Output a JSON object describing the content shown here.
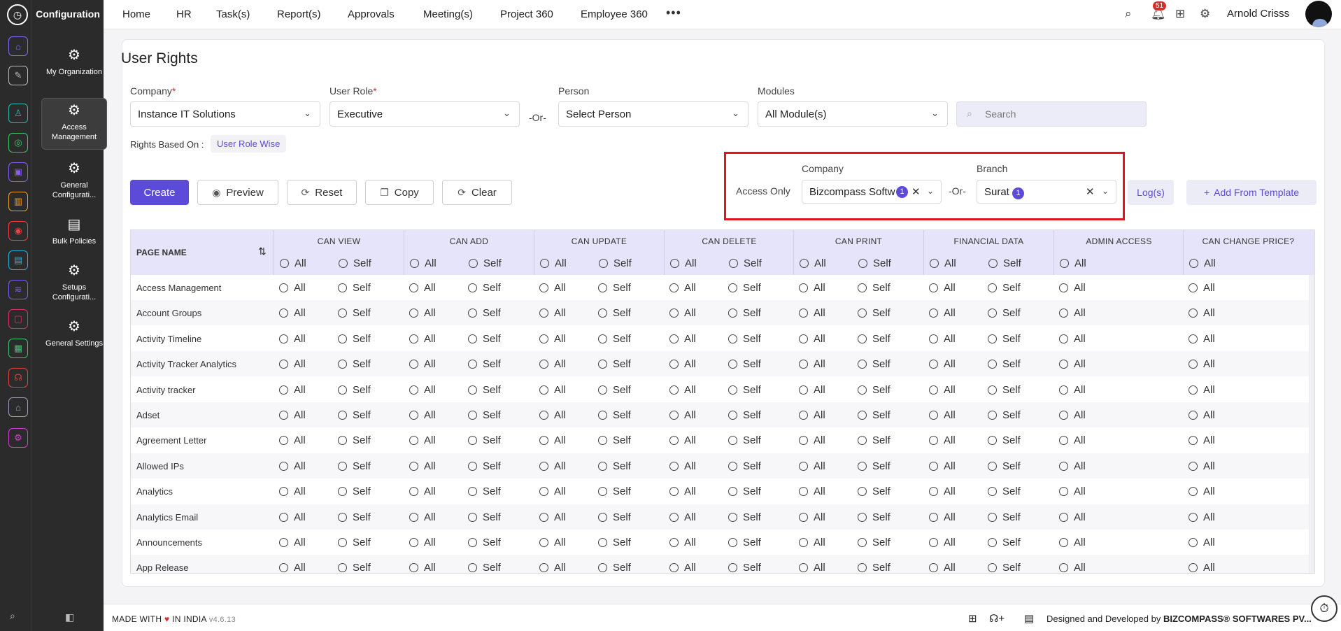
{
  "app": {
    "section_title": "Configuration"
  },
  "rail": {
    "icons": [
      {
        "name": "home-icon",
        "glyph": "⌂",
        "color": "#7a6ff0"
      },
      {
        "name": "pin-icon",
        "glyph": "✎",
        "color": "#bbbbbb"
      },
      {
        "name": "people-icon",
        "glyph": "♙",
        "color": "#2bb8a8"
      },
      {
        "name": "target-icon",
        "glyph": "◎",
        "color": "#3ec46d"
      },
      {
        "name": "briefcase-icon",
        "glyph": "▣",
        "color": "#8a5cf0"
      },
      {
        "name": "chart-icon",
        "glyph": "▥",
        "color": "#f0a020"
      },
      {
        "name": "goal-icon",
        "glyph": "◉",
        "color": "#f04040"
      },
      {
        "name": "document-icon",
        "glyph": "▤",
        "color": "#2ab0e0"
      },
      {
        "name": "layers-icon",
        "glyph": "≋",
        "color": "#7a5cf0"
      },
      {
        "name": "monitor-icon",
        "glyph": "▢",
        "color": "#e0306a"
      },
      {
        "name": "sheet-icon",
        "glyph": "▦",
        "color": "#3ec46d"
      },
      {
        "name": "support-icon",
        "glyph": "☊",
        "color": "#e04040"
      },
      {
        "name": "house-icon",
        "glyph": "⌂",
        "color": "#9aa0b8"
      },
      {
        "name": "settings-app-icon",
        "glyph": "⚙",
        "color": "#d040d0"
      }
    ]
  },
  "sidebar": {
    "items": [
      {
        "label": "My Organization",
        "icon": "org-gear-icon"
      },
      {
        "label": "Access Management",
        "icon": "gear-icon"
      },
      {
        "label": "General Configurati...",
        "icon": "gear-icon"
      },
      {
        "label": "Bulk Policies",
        "icon": "document-icon"
      },
      {
        "label": "Setups Configurati...",
        "icon": "gear-icon"
      },
      {
        "label": "General Settings",
        "icon": "gear-icon"
      }
    ]
  },
  "nav": {
    "items": [
      "Home",
      "HR",
      "Task(s)",
      "Report(s)",
      "Approvals",
      "Meeting(s)",
      "Project 360",
      "Employee 360"
    ],
    "more": "•••",
    "notification_count": "51",
    "user_name": "Arnold Crisss"
  },
  "page": {
    "title": "User Rights",
    "filters": {
      "company_label": "Company",
      "company_value": "Instance IT Solutions",
      "role_label": "User Role",
      "role_value": "Executive",
      "or_label": "-Or-",
      "person_label": "Person",
      "person_placeholder": "Select Person",
      "modules_label": "Modules",
      "modules_value": "All Module(s)",
      "search_placeholder": "Search",
      "required_mark": "*"
    },
    "rights_based_on_label": "Rights Based On :",
    "rights_based_on_value": "User Role Wise",
    "actions": {
      "create": "Create",
      "preview": "Preview",
      "reset": "Reset",
      "copy": "Copy",
      "clear": "Clear"
    },
    "access": {
      "access_only_label": "Access Only",
      "company_label": "Company",
      "company_value": "Bizcompass Softw",
      "company_count": "1",
      "or_label": "-Or-",
      "branch_label": "Branch",
      "branch_value": "Surat",
      "branch_count": "1"
    },
    "log_button": "Log(s)",
    "template_button": "Add From Template"
  },
  "table": {
    "page_header": "PAGE NAME",
    "all_label": "All",
    "self_label": "Self",
    "columns": [
      {
        "name": "CAN VIEW",
        "self": true
      },
      {
        "name": "CAN ADD",
        "self": true
      },
      {
        "name": "CAN UPDATE",
        "self": true
      },
      {
        "name": "CAN DELETE",
        "self": true
      },
      {
        "name": "CAN PRINT",
        "self": true
      },
      {
        "name": "FINANCIAL DATA",
        "self": true
      },
      {
        "name": "ADMIN ACCESS",
        "self": false
      },
      {
        "name": "CAN CHANGE PRICE?",
        "self": false
      }
    ],
    "rows": [
      "Access Management",
      "Account Groups",
      "Activity Timeline",
      "Activity Tracker Analytics",
      "Activity tracker",
      "Adset",
      "Agreement Letter",
      "Allowed IPs",
      "Analytics",
      "Analytics Email",
      "Announcements",
      "App Release"
    ]
  },
  "footer": {
    "made_with": "MADE WITH",
    "in_india": "IN INDIA",
    "version": "v4.6.13",
    "designed_by": "Designed and Developed by",
    "company": "BIZCOMPASS® SOFTWARES PV..."
  }
}
